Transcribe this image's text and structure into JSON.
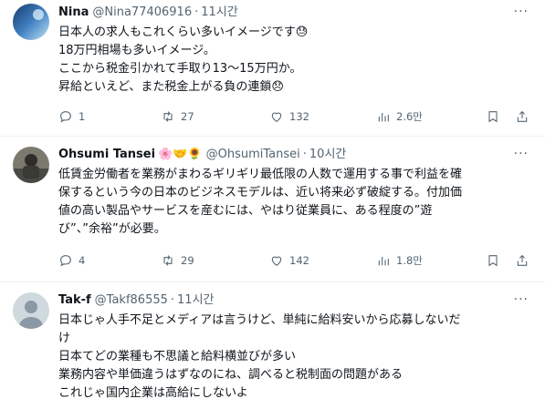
{
  "tweets": [
    {
      "name": "Nina",
      "handle": "@Nina77406916",
      "dot": "·",
      "time": "11시간",
      "more": "···",
      "lines": [
        "日本人の求人もこれくらい多いイメージです😓",
        "18万円相場も多いイメージ。",
        "ここから税金引かれて手取り13～15万円か。",
        "昇給といえど、また税金上がる負の連鎖😞"
      ],
      "replies": "1",
      "retweets": "27",
      "likes": "132",
      "views": "2.6만"
    },
    {
      "name": "Ohsumi Tansei",
      "name_emojis": "🌸🤝🌻",
      "handle": "@OhsumiTansei",
      "dot": "·",
      "time": "10시간",
      "more": "···",
      "lines": [
        "低賃金労働者を業務がまわるギリギリ最低限の人数で運用する事で利益を確",
        "保するという今の日本のビジネスモデルは、近い将来必ず破綻する。付加価",
        "値の高い製品やサービスを産むには、やはり従業員に、ある程度の”遊",
        "び”、”余裕”が必要。"
      ],
      "replies": "4",
      "retweets": "29",
      "likes": "142",
      "views": "1.8만"
    },
    {
      "name": "Tak-f",
      "handle": "@Takf86555",
      "dot": "·",
      "time": "11시간",
      "more": "···",
      "lines": [
        "日本じゃ人手不足とメディアは言うけど、単純に給料安いから応募しないだ",
        "け",
        "日本てどの業種も不思議と給料横並びが多い",
        "業務内容や単価違うはずなのにね、調べると税制面の問題がある",
        "これじゃ国内企業は高給にしないよ"
      ]
    }
  ],
  "colors": {
    "text": "#0f1419",
    "muted": "#536471",
    "border": "#eff3f4"
  },
  "icons": [
    "reply-icon",
    "retweet-icon",
    "like-icon",
    "views-icon",
    "bookmark-icon",
    "share-icon",
    "more-icon"
  ]
}
